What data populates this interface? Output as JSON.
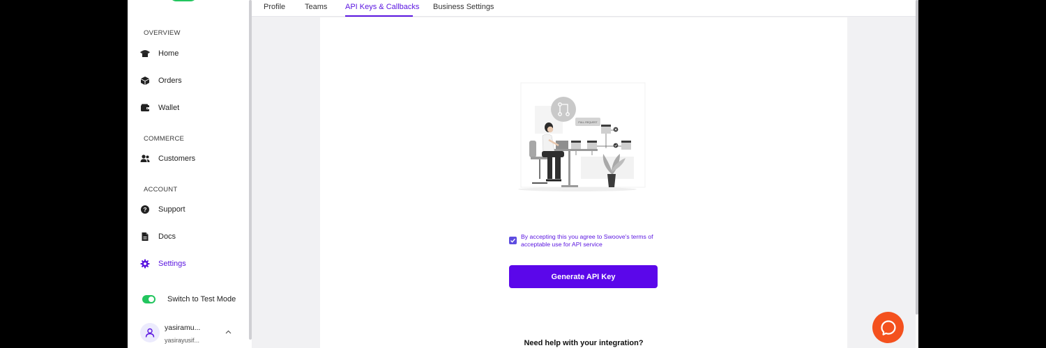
{
  "sidebar": {
    "sections": {
      "overview": "OVERVIEW",
      "commerce": "COMMERCE",
      "account": "ACCOUNT"
    },
    "items": [
      {
        "label": "Home",
        "icon": "home-icon"
      },
      {
        "label": "Orders",
        "icon": "box-icon"
      },
      {
        "label": "Wallet",
        "icon": "wallet-icon"
      },
      {
        "label": "Customers",
        "icon": "users-icon"
      },
      {
        "label": "Support",
        "icon": "help-circle-icon"
      },
      {
        "label": "Docs",
        "icon": "document-icon"
      },
      {
        "label": "Settings",
        "icon": "gear-icon",
        "active": true
      }
    ],
    "test_mode_label": "Switch to Test Mode",
    "test_mode_on": true,
    "user": {
      "name": "yasiramu...",
      "email": "yasirayusif..."
    }
  },
  "tabs": [
    {
      "label": "Profile"
    },
    {
      "label": "Teams"
    },
    {
      "label": "API Keys & Callbacks",
      "active": true
    },
    {
      "label": "Business Settings"
    }
  ],
  "main": {
    "illustration_text": "PULL REQUEST",
    "consent_text": "By accepting this you agree to Swoove's terms of acceptable use for API service",
    "consent_checked": true,
    "generate_button": "Generate API Key",
    "help_text": "Need help with your integration?"
  },
  "colors": {
    "accent": "#5b16e0",
    "toggle_on": "#22c55e",
    "chat_bubble": "#f4511e"
  }
}
